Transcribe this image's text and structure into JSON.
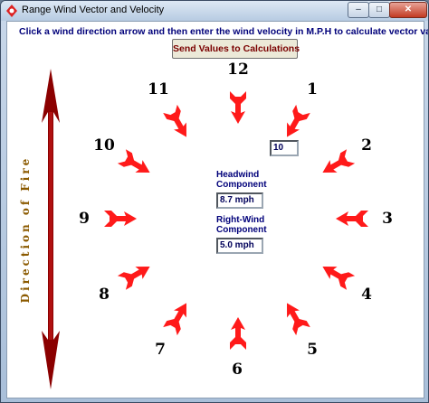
{
  "window": {
    "title": "Range Wind Vector and Velocity",
    "minimize": "–",
    "maximize": "□",
    "close": "✕"
  },
  "instructions": "Click a wind direction arrow and then enter the wind velocity in M.P.H to calculate vector values",
  "send_button": "Send Values to Calculations",
  "clock_numbers": [
    "12",
    "1",
    "2",
    "3",
    "4",
    "5",
    "6",
    "7",
    "8",
    "9",
    "10",
    "11"
  ],
  "wind_velocity": "10",
  "headwind": {
    "label_line1": "Headwind",
    "label_line2": "Component",
    "value": "8.7 mph"
  },
  "rightwind": {
    "label_line1": "Right-Wind",
    "label_line2": "Component",
    "value": "5.0 mph"
  },
  "fire_label": "Direction of Fire",
  "colors": {
    "arrow": "#ff1a1a",
    "fire_arrow": "#8b0000",
    "label_text": "#00007a",
    "fire_text": "#8b5a00"
  },
  "icons": [
    "app-icon",
    "wind-direction-arrow",
    "fire-direction-arrow"
  ]
}
